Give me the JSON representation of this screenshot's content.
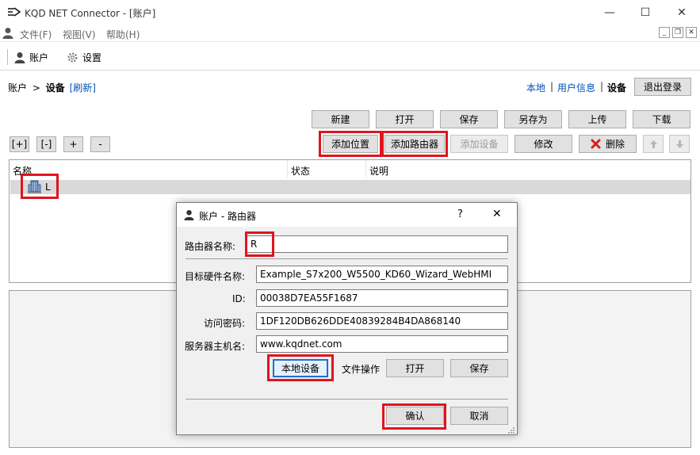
{
  "window": {
    "title": "KQD NET Connector - [账户]",
    "controls": {
      "minimize": "—",
      "maximize": "☐",
      "close": "✕"
    }
  },
  "menu": {
    "items": [
      "文件(F)",
      "视图(V)",
      "帮助(H)"
    ],
    "mdi": {
      "minimize": "_",
      "restore": "❐",
      "close": "✕"
    }
  },
  "toolbar": {
    "account_label": "账户",
    "settings_label": "设置"
  },
  "breadcrumb": {
    "root": "账户",
    "sep": ">",
    "current": "设备",
    "refresh": "[刷新]"
  },
  "nav": {
    "local": "本地",
    "sep": "|",
    "user_info": "用户信息",
    "device": "设备",
    "logout": "退出登录"
  },
  "file_buttons": {
    "new": "新建",
    "open": "打开",
    "save": "保存",
    "save_as": "另存为",
    "upload": "上传",
    "download": "下载"
  },
  "tree_buttons": {
    "expand": "[+]",
    "collapse": "[-]",
    "plus": "+",
    "minus": "-"
  },
  "action_buttons": {
    "add_location": "添加位置",
    "add_router": "添加路由器",
    "add_device": "添加设备",
    "modify": "修改",
    "delete": "删除"
  },
  "tree": {
    "columns": [
      "名称",
      "状态",
      "说明"
    ],
    "rows": [
      {
        "name": "L",
        "status": "",
        "desc": ""
      }
    ]
  },
  "dialog": {
    "title": "账户 - 路由器",
    "help": "?",
    "close": "✕",
    "router_name_label": "路由器名称:",
    "router_name_value": "R",
    "target_label": "目标硬件名称:",
    "target_value": "Example_S7x200_W5500_KD60_Wizard_WebHMI",
    "id_label": "ID:",
    "id_value": "00038D7EA55F1687",
    "password_label": "访问密码:",
    "password_value": "1DF120DB626DDE40839284B4DA868140",
    "server_label": "服务器主机名:",
    "server_value": "www.kqdnet.com",
    "local_device": "本地设备",
    "file_ops": "文件操作",
    "open": "打开",
    "save": "保存",
    "confirm": "确认",
    "cancel": "取消"
  },
  "colors": {
    "highlight": "#e0141e",
    "link": "#0050b8",
    "delete_icon": "#d61f1f"
  }
}
